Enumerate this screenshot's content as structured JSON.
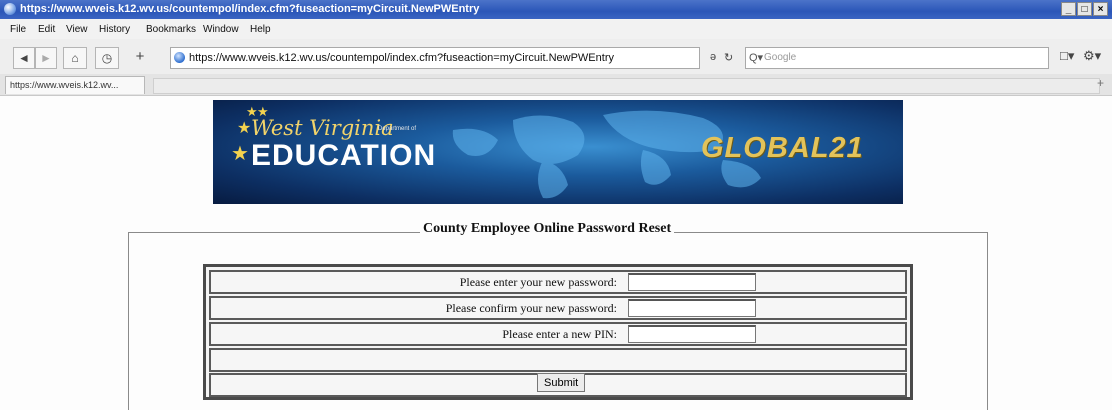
{
  "window": {
    "title": "https://www.wveis.k12.wv.us/countempol/index.cfm?fuseaction=myCircuit.NewPWEntry",
    "controls": [
      "_",
      "́",
      "×"
    ]
  },
  "menu": [
    "File",
    "Edit",
    "View",
    "History",
    "Bookmarks",
    "Window",
    "Help"
  ],
  "nav": {
    "back": "◄",
    "forward": "►",
    "home": "⌂",
    "history": "◷",
    "add": "+",
    "url": "https://www.wveis.k12.wv.us/countempol/index.cfm?fuseaction=myCircuit.NewPWEntry",
    "url_controls": "ə C",
    "search_placeholder": "Google",
    "page_menu": "□▾",
    "tools_menu": "⚙▾"
  },
  "tab": {
    "label": "https://www.wveis.k12.wv...",
    "new_tab": "+"
  },
  "banner": {
    "state_name": "West Virginia",
    "department": "Department of",
    "education": "EDUCATION",
    "program": "GLOBAL21"
  },
  "form": {
    "legend": "County Employee Online Password Reset",
    "new_password_label": "Please enter your new password:",
    "confirm_password_label": "Please confirm your new password:",
    "pin_label": "Please enter a new PIN:",
    "new_password_value": "",
    "confirm_password_value": "",
    "pin_value": "",
    "submit_label": "Submit"
  }
}
